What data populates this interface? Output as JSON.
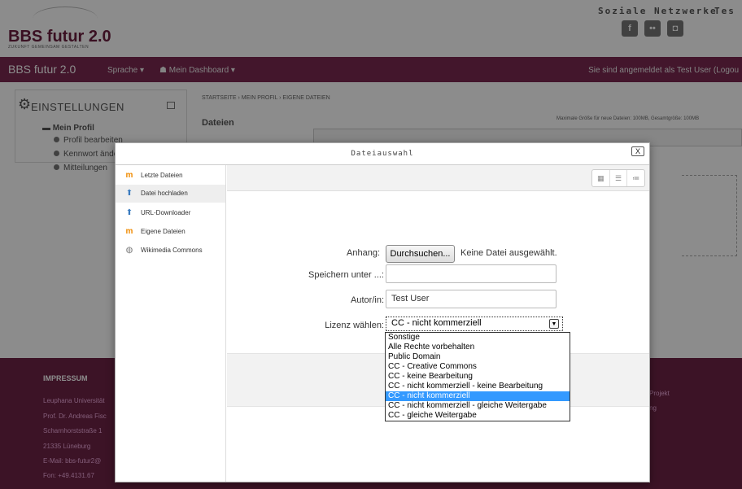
{
  "site": {
    "logo_title": "BBS futur 2.0",
    "logo_sub": "ZUKUNFT GEMEINSAM GESTALTEN",
    "social_label": "Soziale Netzwerke",
    "test_label": "Tes"
  },
  "navbar": {
    "brand": "BBS futur 2.0",
    "language": "Sprache ▾",
    "dashboard": "Mein Dashboard ▾",
    "login_status": "Sie sind angemeldet als Test User (Logou"
  },
  "settings": {
    "title": "EINSTELLUNGEN",
    "profile": "Mein Profil",
    "links": [
      "Profil bearbeiten",
      "Kennwort ände",
      "Mitteilungen"
    ]
  },
  "main": {
    "breadcrumb": "STARTSEITE › MEIN PROFIL › EIGENE DATEIEN",
    "heading": "Dateien",
    "maxsize": "Maximale Größe für neue Dateien: 100MB, Gesamtgröße: 100MB"
  },
  "footer": {
    "heading": "IMPRESSUM",
    "lines": [
      "Leuphana Universität",
      "Prof. Dr. Andreas Fisc",
      "Scharnhorststraße 1",
      "21335 Lüneburg",
      "E-Mail:  bbs-futur2@",
      "Fon:    +49.4131.67"
    ],
    "right_lines": [
      "Projekt",
      "ng"
    ]
  },
  "dialog": {
    "title": "Dateiauswahl",
    "close": "X",
    "repositories": [
      {
        "label": "Letzte Dateien",
        "icon": "moodle-icon",
        "active": false
      },
      {
        "label": "Datei hochladen",
        "icon": "upload-icon",
        "active": true
      },
      {
        "label": "URL-Downloader",
        "icon": "url-icon",
        "active": false
      },
      {
        "label": "Eigene Dateien",
        "icon": "moodle-icon",
        "active": false
      },
      {
        "label": "Wikimedia Commons",
        "icon": "wikimedia-icon",
        "active": false
      }
    ],
    "form": {
      "attachment_label": "Anhang:",
      "browse_button": "Durchsuchen...",
      "no_file": "Keine Datei ausgewählt.",
      "save_as_label": "Speichern unter ...:",
      "save_as_value": "",
      "author_label": "Autor/in:",
      "author_value": "Test User",
      "license_label": "Lizenz wählen:",
      "license_value": "CC - nicht kommerziell"
    },
    "license_options": [
      "Sonstige",
      "Alle Rechte vorbehalten",
      "Public Domain",
      "CC - Creative Commons",
      "CC - keine Bearbeitung",
      "CC - nicht kommerziell - keine Bearbeitung",
      "CC - nicht kommerziell",
      "CC - nicht kommerziell - gleiche Weitergabe",
      "CC - gleiche Weitergabe"
    ],
    "selected_option_index": 6
  },
  "colors": {
    "brand": "#7a2950",
    "footer": "#6e2346",
    "selection": "#3399ff"
  }
}
